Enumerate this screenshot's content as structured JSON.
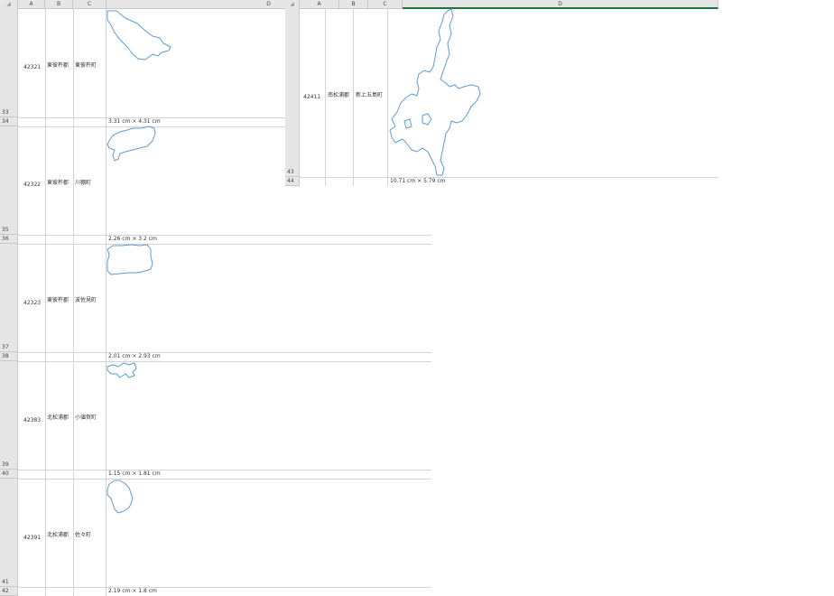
{
  "left_sheet": {
    "corner": "◢",
    "columns": [
      "A",
      "B",
      "C",
      "D"
    ],
    "rows": [
      {
        "row_num": "33",
        "dim_row": "34",
        "code": "42321",
        "district": "東彼杵郡",
        "town": "東彼杵町",
        "size": "3.31 cm × 4.31 cm"
      },
      {
        "row_num": "35",
        "dim_row": "36",
        "code": "42322",
        "district": "東彼杵郡",
        "town": "川棚町",
        "size": "2.26 cm × 3.2 cm"
      },
      {
        "row_num": "37",
        "dim_row": "38",
        "code": "42323",
        "district": "東彼杵郡",
        "town": "波佐見町",
        "size": "2.01 cm × 2.93 cm"
      },
      {
        "row_num": "39",
        "dim_row": "40",
        "code": "42383",
        "district": "北松浦郡",
        "town": "小値賀町",
        "size": "1.15 cm × 1.81 cm"
      },
      {
        "row_num": "41",
        "dim_row": "42",
        "code": "42391",
        "district": "北松浦郡",
        "town": "佐々町",
        "size": "2.19 cm × 1.8 cm"
      }
    ]
  },
  "right_sheet": {
    "corner": "◢",
    "columns": [
      "A",
      "B",
      "C",
      "D"
    ],
    "row": {
      "row_num": "43",
      "dim_row": "44",
      "code": "42411",
      "district": "南松浦郡",
      "town": "新上五島町",
      "size": "10.71 cm × 5.79 cm"
    }
  },
  "colors": {
    "outline": "#5b9bd5",
    "header": "#e6e6e6",
    "selected_col": "#217346"
  }
}
